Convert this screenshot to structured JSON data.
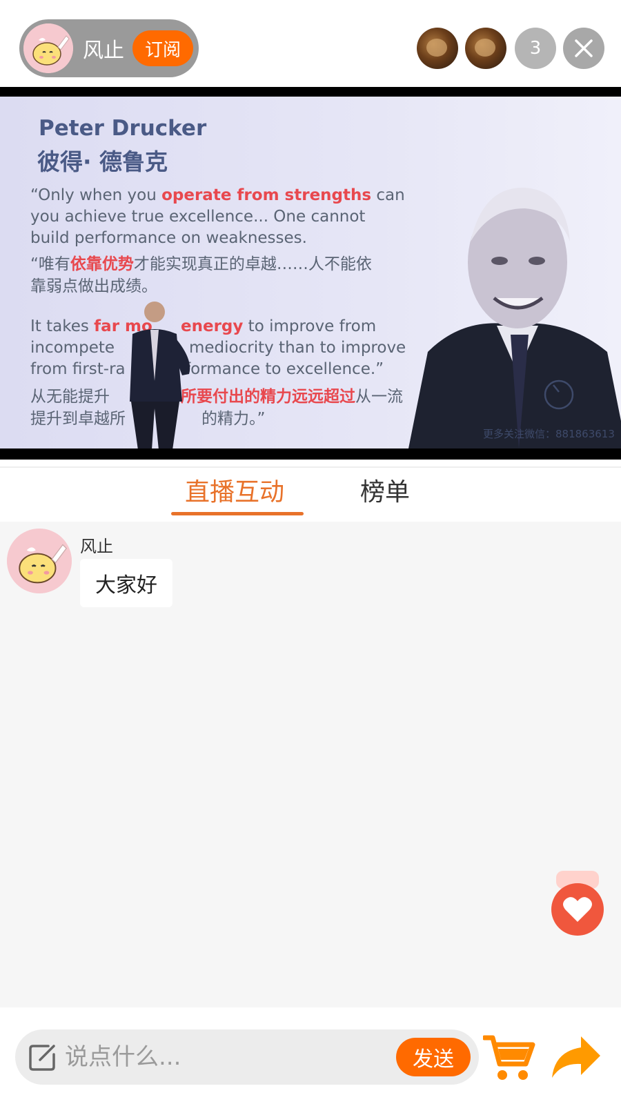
{
  "host": {
    "name": "风止",
    "subscribe_label": "订阅",
    "avatar_icon": "chick-avatar-icon"
  },
  "viewers": {
    "avatars": [
      "viewer-avatar-1",
      "viewer-avatar-2"
    ],
    "count": "3"
  },
  "video": {
    "slide": {
      "title_en": "Peter Drucker",
      "title_cn": "彼得· 德鲁克",
      "lines": [
        {
          "pre": "“Only when you ",
          "hl": "operate from strengths",
          "post": " can"
        },
        {
          "pre": "you achieve true excellence...  One cannot",
          "hl": "",
          "post": ""
        },
        {
          "pre": "build performance on weaknesses.",
          "hl": "",
          "post": ""
        },
        {
          "pre": "“唯有",
          "hl": "依靠优势",
          "post": "才能实现真正的卓越……人不能依"
        },
        {
          "pre": "靠弱点做出成绩。",
          "hl": "",
          "post": ""
        },
        {
          "pre": "It takes ",
          "hl": "far mo",
          "post": ""
        },
        {
          "pre": "incompete",
          "hl": "",
          "post": ""
        },
        {
          "pre": "from first-ra",
          "hl": "",
          "post": ""
        },
        {
          "pre": "从无能提升",
          "hl": "",
          "post": ""
        },
        {
          "pre": "提升到卓越所",
          "hl": "",
          "post": ""
        }
      ],
      "lines_right": [
        {
          "pre": "",
          "hl": "energy",
          "post": " to improve from"
        },
        {
          "pre": "mediocrity than to improve",
          "hl": "",
          "post": ""
        },
        {
          "pre": "formance to excellence.”",
          "hl": "",
          "post": ""
        },
        {
          "pre": "",
          "hl": "所要付出的精力远远超过",
          "post": "从一流"
        },
        {
          "pre": "的精力。”",
          "hl": "",
          "post": ""
        }
      ],
      "watermark": "更多关注微信：881863613"
    }
  },
  "tabs": [
    {
      "label": "直播互动",
      "active": true
    },
    {
      "label": "榜单",
      "active": false
    }
  ],
  "chat": {
    "messages": [
      {
        "user": "风止",
        "text": "大家好"
      }
    ]
  },
  "bottom": {
    "comment_placeholder": "说点什么...",
    "send_label": "发送"
  },
  "colors": {
    "accent": "#ff6a00",
    "tab_active": "#e8722a",
    "slide_highlight": "#e8484e"
  }
}
